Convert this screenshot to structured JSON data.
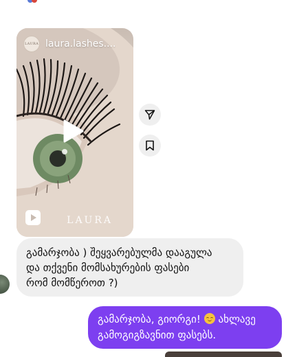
{
  "reel": {
    "username": "laura.lashes....",
    "avatar_text": "LAURA",
    "brand_watermark": "LAURA",
    "icons": {
      "play": "play-icon",
      "type": "reels-icon"
    }
  },
  "actions": {
    "share_icon": "send-icon",
    "save_icon": "bookmark-icon"
  },
  "messages": {
    "incoming": {
      "line1": "გამარჯობა ) შეყვარებულმა დააგულა",
      "line2": "და თქვენი მომსახურების ფასები",
      "line3": "რომ მომწეროთ ?)"
    },
    "outgoing": {
      "part1": "გამარჯობა, გიორგი!",
      "emoji": "smiling-face-emoji",
      "part2": "ახლავე",
      "line2": "გამოგიგზავნით ფასებს."
    }
  },
  "colors": {
    "outgoing_bubble": "#7d3ff0",
    "incoming_bubble": "#efefef"
  }
}
